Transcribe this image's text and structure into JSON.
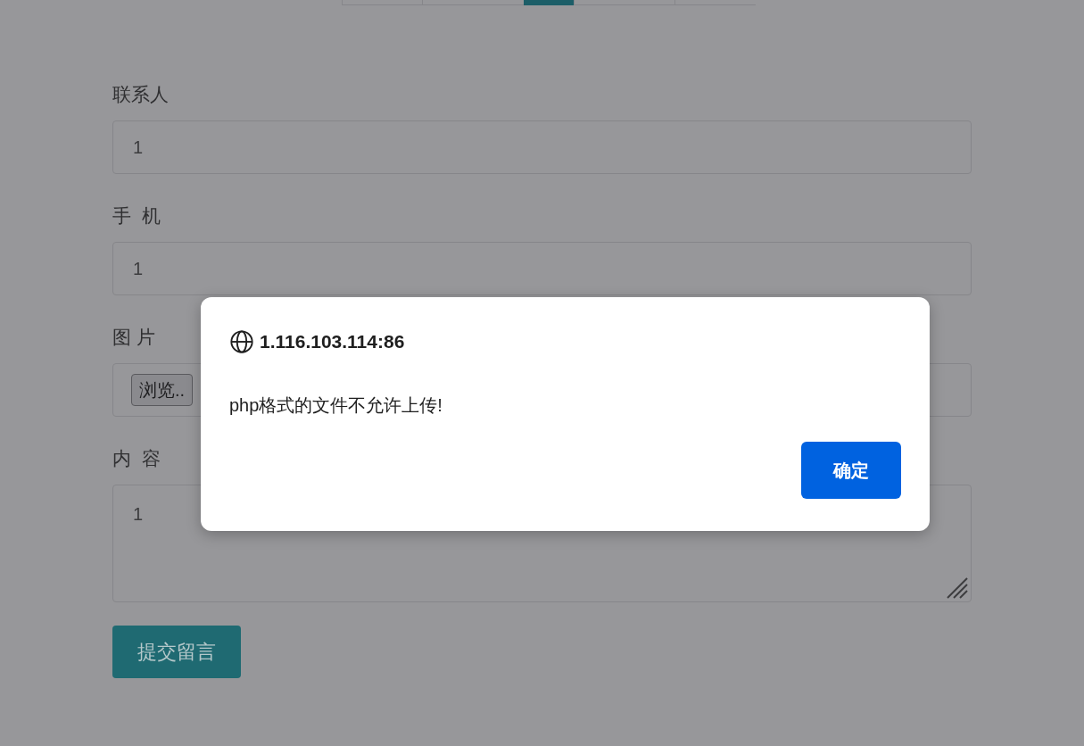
{
  "nav_tabs": [
    {
      "selected": false
    },
    {
      "selected": false
    },
    {
      "selected": true
    },
    {
      "selected": false
    },
    {
      "selected": false
    }
  ],
  "form": {
    "fields": [
      {
        "kind": "text",
        "label": "联系人",
        "value": "1"
      },
      {
        "kind": "text",
        "label": "手  机",
        "value": "1"
      },
      {
        "kind": "file",
        "label": "图 片",
        "button": "浏览.."
      },
      {
        "kind": "textarea",
        "label": "内  容",
        "value": "1"
      }
    ],
    "submit": "提交留言"
  },
  "dialog": {
    "title": "1.116.103.114:86",
    "message": "php格式的文件不允许上传!",
    "button": "确定"
  }
}
